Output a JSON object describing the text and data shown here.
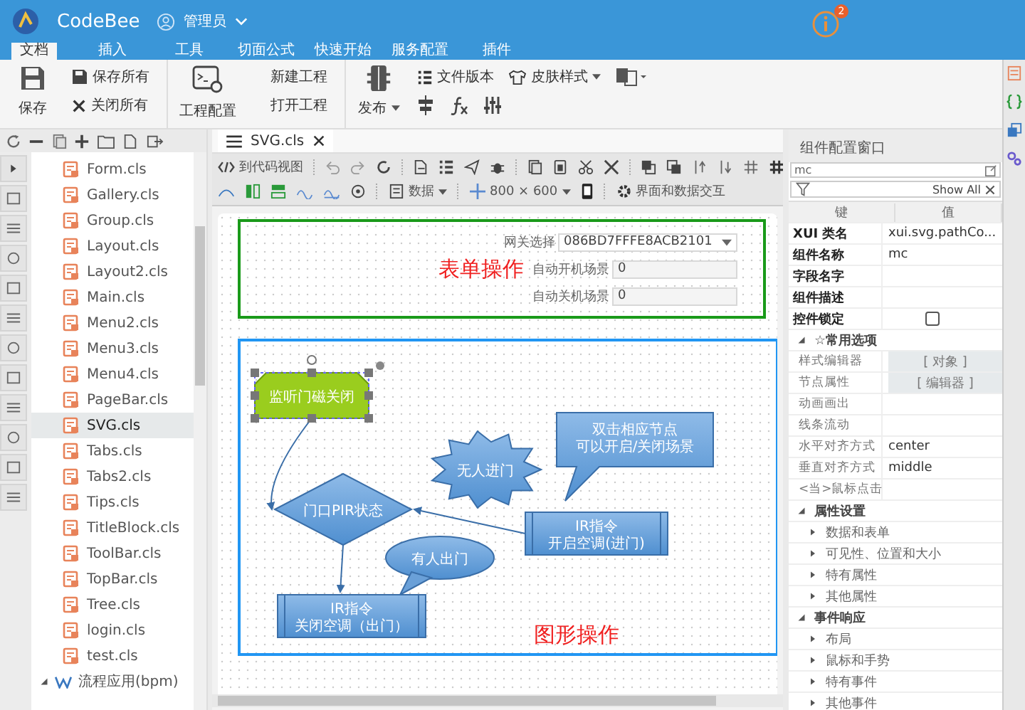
{
  "header": {
    "app_name": "CodeBee",
    "user": "管理员",
    "notification_count": "2"
  },
  "menu_tabs": [
    {
      "label": "文档",
      "selected": true
    },
    {
      "label": "插入",
      "selected": false
    },
    {
      "label": "工具",
      "selected": false
    },
    {
      "label": "切面公式",
      "selected": false
    },
    {
      "label": "快速开始",
      "selected": false
    },
    {
      "label": "服务配置",
      "selected": false
    },
    {
      "label": "插件",
      "selected": false
    }
  ],
  "ribbon": {
    "save": "保存",
    "save_all": "保存所有",
    "close_all": "关闭所有",
    "project_config": "工程配置",
    "new_project": "新建工程",
    "open_project": "打开工程",
    "publish": "发布",
    "file_version": "文件版本",
    "skin_style": "皮肤样式"
  },
  "file_tree": {
    "items": [
      {
        "label": "Form.cls",
        "selected": false
      },
      {
        "label": "Gallery.cls",
        "selected": false
      },
      {
        "label": "Group.cls",
        "selected": false
      },
      {
        "label": "Layout.cls",
        "selected": false
      },
      {
        "label": "Layout2.cls",
        "selected": false
      },
      {
        "label": "Main.cls",
        "selected": false
      },
      {
        "label": "Menu2.cls",
        "selected": false
      },
      {
        "label": "Menu3.cls",
        "selected": false
      },
      {
        "label": "Menu4.cls",
        "selected": false
      },
      {
        "label": "PageBar.cls",
        "selected": false
      },
      {
        "label": "SVG.cls",
        "selected": true
      },
      {
        "label": "Tabs.cls",
        "selected": false
      },
      {
        "label": "Tabs2.cls",
        "selected": false
      },
      {
        "label": "Tips.cls",
        "selected": false
      },
      {
        "label": "TitleBlock.cls",
        "selected": false
      },
      {
        "label": "ToolBar.cls",
        "selected": false
      },
      {
        "label": "TopBar.cls",
        "selected": false
      },
      {
        "label": "Tree.cls",
        "selected": false
      },
      {
        "label": "login.cls",
        "selected": false
      },
      {
        "label": "test.cls",
        "selected": false
      }
    ],
    "folder": {
      "label": "流程应用(bpm)",
      "expanded": true
    }
  },
  "editor": {
    "tab": "SVG.cls",
    "code_view": "到代码视图",
    "data_menu": "数据",
    "canvas_size": "800 × 600",
    "interaction": "界面和数据交互"
  },
  "form": {
    "title": "表单操作",
    "fields": [
      {
        "kind": "select",
        "label": "网关选择",
        "value": "086BD7FFFE8ACB2101"
      },
      {
        "kind": "text",
        "label": "自动开机场景",
        "value": "0"
      },
      {
        "kind": "text",
        "label": "自动关机场景",
        "value": "0"
      }
    ]
  },
  "diagram": {
    "title": "图形操作",
    "nodes": [
      {
        "kind": "tab-shape",
        "lines": [
          "监听门磁关闭"
        ],
        "selected": true
      },
      {
        "kind": "diamond",
        "lines": [
          "门口PIR状态"
        ],
        "selected": false
      },
      {
        "kind": "burst",
        "lines": [
          "无人进门"
        ],
        "selected": false
      },
      {
        "kind": "callout-rect",
        "lines": [
          "双击相应节点",
          "可以开启/关闭场景"
        ],
        "selected": false
      },
      {
        "kind": "process",
        "lines": [
          "IR指令",
          "开启空调(进门)"
        ],
        "selected": false
      },
      {
        "kind": "callout-oval",
        "lines": [
          "有人出门"
        ],
        "selected": false
      },
      {
        "kind": "process",
        "lines": [
          "IR指令",
          "关闭空调（出门）"
        ],
        "selected": false
      }
    ]
  },
  "properties": {
    "title": "组件配置窗口",
    "search_value": "mc",
    "filter_label": "Show All",
    "columns": [
      "键",
      "值"
    ],
    "rows": [
      {
        "kind": "prop",
        "key": "XUI 类名",
        "value": "xui.svg.pathCo..."
      },
      {
        "kind": "prop",
        "key": "组件名称",
        "value": "mc"
      },
      {
        "kind": "prop",
        "key": "字段名字"
      },
      {
        "kind": "prop",
        "key": "组件描述"
      },
      {
        "kind": "check",
        "key": "控件锁定",
        "checked": false
      },
      {
        "kind": "group",
        "key": "☆常用选项",
        "expanded": true,
        "children": [
          {
            "kind": "button",
            "key": "样式编辑器",
            "value": "[ 对象 ]"
          },
          {
            "kind": "button",
            "key": "节点属性",
            "value": "[ 编辑器 ]"
          },
          {
            "kind": "prop",
            "key": "动画画出"
          },
          {
            "kind": "prop",
            "key": "线条流动"
          },
          {
            "kind": "prop",
            "key": "水平对齐方式",
            "value": "center"
          },
          {
            "kind": "prop",
            "key": "垂直对齐方式",
            "value": "middle"
          },
          {
            "kind": "prop",
            "key": "<当>鼠标点击"
          }
        ]
      },
      {
        "kind": "group",
        "key": "属性设置",
        "expanded": true,
        "children": [
          {
            "kind": "subgroup",
            "key": "数据和表单",
            "expanded": false
          },
          {
            "kind": "subgroup",
            "key": "可见性、位置和大小",
            "expanded": false
          },
          {
            "kind": "subgroup",
            "key": "特有属性",
            "expanded": false
          },
          {
            "kind": "subgroup",
            "key": "其他属性",
            "expanded": false
          }
        ]
      },
      {
        "kind": "group",
        "key": "事件响应",
        "expanded": true,
        "children": [
          {
            "kind": "subgroup",
            "key": "布局",
            "expanded": false
          },
          {
            "kind": "subgroup",
            "key": "鼠标和手势",
            "expanded": false
          },
          {
            "kind": "subgroup",
            "key": "特有事件",
            "expanded": false
          },
          {
            "kind": "subgroup",
            "key": "其他事件",
            "expanded": false
          }
        ]
      }
    ]
  }
}
